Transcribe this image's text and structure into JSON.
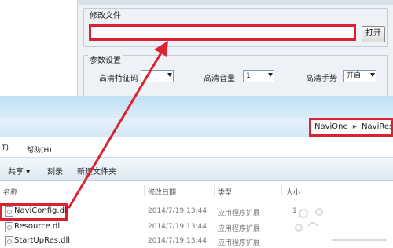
{
  "tool": {
    "file_group_title": "修改文件",
    "file_path_value": "",
    "open_button": "打开",
    "params_group_title": "参数设置",
    "hd_marker_label": "高清特征码",
    "hd_volume_label": "高清音量",
    "hd_volume_value": "1",
    "hd_gesture_label": "高清手势",
    "hd_gesture_value": "开启"
  },
  "explorer": {
    "breadcrumb": [
      "NaviOne",
      "NaviResFile"
    ],
    "breadcrumb_sep": "▸",
    "menu": {
      "tools": "T)",
      "help": "帮助(H)"
    },
    "toolbar": {
      "share": "共享 ▾",
      "burn": "刻录",
      "new_folder": "新建文件夹"
    },
    "columns": {
      "name": "名称",
      "date": "修改日期",
      "type": "类型",
      "size": "大小"
    },
    "files": [
      {
        "name": "NaviConfig.dll",
        "date": "2014/7/19 13:44",
        "type": "应用程序扩展",
        "size": "1"
      },
      {
        "name": "Resource.dll",
        "date": "2014/7/19 13:44",
        "type": "应用程序扩展",
        "size": ""
      },
      {
        "name": "StartUpRes.dll",
        "date": "2014/7/19 13:44",
        "type": "应用程序扩展",
        "size": ""
      }
    ]
  },
  "colors": {
    "highlight": "#d92332",
    "arrow": "#d92332"
  }
}
